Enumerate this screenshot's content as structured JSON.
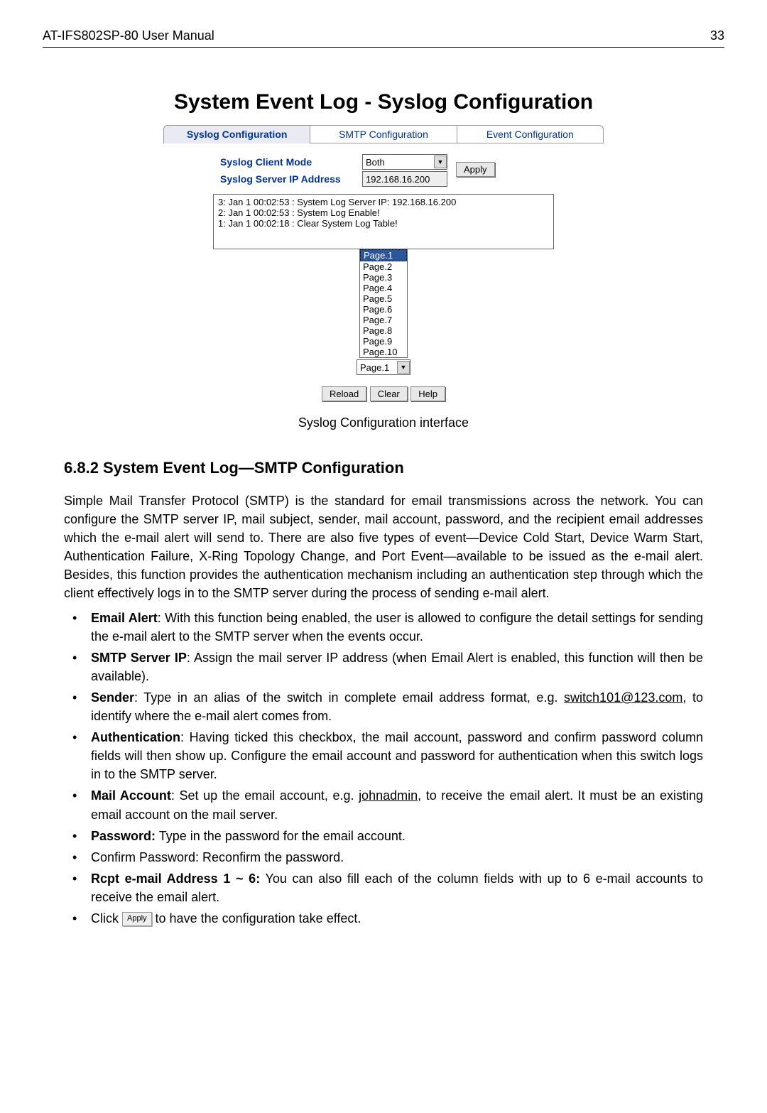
{
  "header": {
    "title": "AT-IFS802SP-80 User Manual",
    "page_number": "33"
  },
  "page_title": "System Event Log - Syslog Configuration",
  "tabs": {
    "syslog": "Syslog Configuration",
    "smtp": "SMTP Configuration",
    "event": "Event Configuration"
  },
  "config": {
    "mode_label": "Syslog Client Mode",
    "mode_value": "Both",
    "ip_label": "Syslog Server IP Address",
    "ip_value": "192.168.16.200",
    "apply_label": "Apply"
  },
  "log_entries": {
    "e1": "3: Jan 1 00:02:53 : System Log Server IP: 192.168.16.200",
    "e2": "2: Jan 1 00:02:53 : System Log Enable!",
    "e3": "1: Jan 1 00:02:18 : Clear System Log Table!"
  },
  "pages": {
    "p1": "Page.1",
    "p2": "Page.2",
    "p3": "Page.3",
    "p4": "Page.4",
    "p5": "Page.5",
    "p6": "Page.6",
    "p7": "Page.7",
    "p8": "Page.8",
    "p9": "Page.9",
    "p10": "Page.10",
    "selected": "Page.1"
  },
  "buttons": {
    "reload": "Reload",
    "clear": "Clear",
    "help": "Help"
  },
  "caption": "Syslog Configuration interface",
  "section": {
    "heading": "6.8.2  System Event Log—SMTP Configuration",
    "para": "Simple Mail Transfer Protocol (SMTP) is the standard for email transmissions across the network. You can configure the SMTP server IP, mail subject, sender, mail account, password, and the recipient email addresses which the e-mail alert will send to. There are also five types of event—Device Cold Start, Device Warm Start, Authentication Failure, X-Ring Topology Change, and Port Event—available to be issued as the e-mail alert. Besides, this function provides the authentication mechanism including an authentication step through which the client effectively logs in to the SMTP server during the process of sending e-mail alert."
  },
  "bullets": {
    "b1": {
      "label": "Email Alert",
      "text": ": With this function being enabled, the user is allowed to configure the detail settings for sending the e-mail alert to the SMTP server when the events occur."
    },
    "b2": {
      "label": "SMTP Server IP",
      "text": ": Assign the mail server IP address (when Email Alert is enabled, this function will then be available)."
    },
    "b3": {
      "label": "Sender",
      "pre": ": Type in an alias of the switch in complete email address format, e.g. ",
      "link": "switch101@123.com",
      "post": ", to identify where the e-mail alert comes from."
    },
    "b4": {
      "label": "Authentication",
      "text": ": Having ticked this checkbox, the mail account, password and confirm password column fields will then show up. Configure the email account and password for authentication when this switch logs in to the SMTP server."
    },
    "b5": {
      "label": "Mail Account",
      "pre": ": Set up the email account, e.g. ",
      "link": "johnadmin",
      "post": ", to receive the email alert. It must be an existing email account on the mail server."
    },
    "b6": {
      "label": "Password:",
      "text": " Type in the password for the email account."
    },
    "b7": {
      "text": "Confirm Password: Reconfirm the password."
    },
    "b8": {
      "label": "Rcpt e-mail Address 1 ~ 6:",
      "text": " You can also fill each of the column fields with up to 6 e-mail accounts to receive the email alert."
    },
    "b9": {
      "pre": "Click ",
      "btn": "Apply",
      "post": " to have the configuration take effect."
    }
  }
}
